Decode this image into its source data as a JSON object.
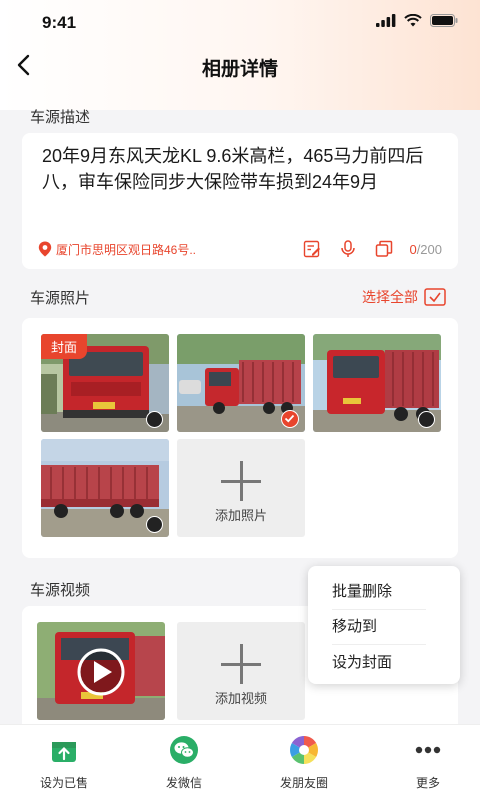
{
  "status": {
    "time": "9:41"
  },
  "header": {
    "title": "相册详情"
  },
  "description": {
    "section_title": "车源描述",
    "text": "20年9月东风天龙KL 9.6米高栏，465马力前四后八，审车保险同步大保险带车损到24年9月",
    "location": "厦门市思明区观日路46号..",
    "count": "0",
    "max": "/200"
  },
  "photos": {
    "section_title": "车源照片",
    "select_all": "选择全部",
    "cover_badge": "封面",
    "add_label": "添加照片",
    "items": [
      {
        "selected": false,
        "cover": true
      },
      {
        "selected": true,
        "cover": false
      },
      {
        "selected": false,
        "cover": false
      },
      {
        "selected": false,
        "cover": false
      }
    ]
  },
  "videos": {
    "section_title": "车源视频",
    "add_label": "添加视频"
  },
  "context_menu": {
    "items": [
      "批量删除",
      "移动到",
      "设为封面"
    ]
  },
  "tabbar": {
    "items": [
      {
        "label": "设为已售",
        "icon": "sold-icon"
      },
      {
        "label": "发微信",
        "icon": "wechat-icon"
      },
      {
        "label": "发朋友圈",
        "icon": "moments-icon"
      },
      {
        "label": "更多",
        "icon": "more-icon"
      }
    ]
  },
  "colors": {
    "accent": "#e8452d",
    "wechat": "#2aae67"
  }
}
